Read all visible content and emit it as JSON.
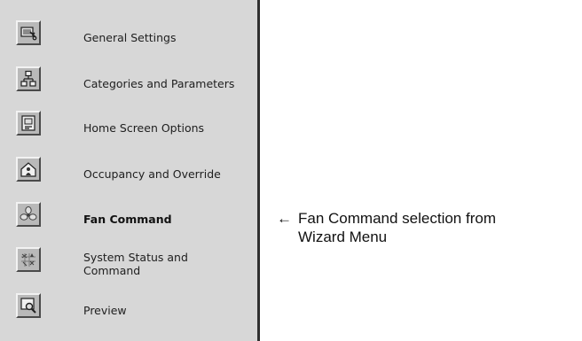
{
  "wizard_menu": {
    "items": [
      {
        "label": "General Settings",
        "icon": "general-settings-icon"
      },
      {
        "label": "Categories and Parameters",
        "icon": "categories-icon"
      },
      {
        "label": "Home Screen Options",
        "icon": "home-screen-icon"
      },
      {
        "label": "Occupancy and Override",
        "icon": "occupancy-icon"
      },
      {
        "label": "Fan Command",
        "icon": "fan-icon",
        "selected": true
      },
      {
        "label": "System Status and Command",
        "icon": "system-status-icon"
      },
      {
        "label": "Preview",
        "icon": "preview-icon"
      }
    ]
  },
  "annotation": {
    "arrow": "←",
    "line1": "Fan Command selection from",
    "line2": "Wizard Menu"
  },
  "colors": {
    "menu_background": "#d7d7d7",
    "menu_border": "#303030",
    "icon_face": "#b9b9b9"
  }
}
